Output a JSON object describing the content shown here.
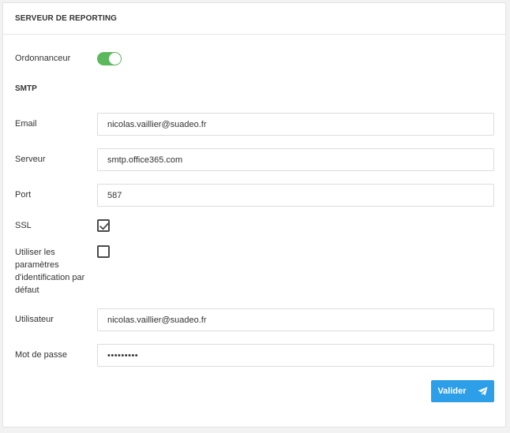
{
  "panel": {
    "title": "SERVEUR DE REPORTING"
  },
  "scheduler": {
    "label": "Ordonnanceur",
    "enabled": true
  },
  "smtp": {
    "section_title": "SMTP",
    "email": {
      "label": "Email",
      "value": "nicolas.vaillier@suadeo.fr"
    },
    "server": {
      "label": "Serveur",
      "value": "smtp.office365.com"
    },
    "port": {
      "label": "Port",
      "value": "587"
    },
    "ssl": {
      "label": "SSL",
      "checked": true
    },
    "default_credentials": {
      "label_lines": [
        "Utiliser les",
        "paramètres",
        "d'identification par",
        "défaut"
      ],
      "checked": false
    },
    "user": {
      "label": "Utilisateur",
      "value": "nicolas.vaillier@suadeo.fr"
    },
    "password": {
      "label": "Mot de passe",
      "masked_value": "•••••••••"
    }
  },
  "actions": {
    "submit_label": "Valider",
    "submit_icon": "send-icon"
  },
  "colors": {
    "toggle_on": "#5cb85c",
    "primary_button": "#2d9ee8"
  }
}
